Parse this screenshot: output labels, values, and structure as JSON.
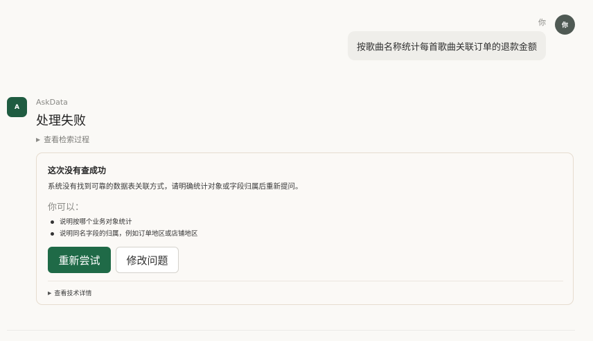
{
  "user": {
    "name": "你",
    "avatar_label": "你",
    "message": "按歌曲名称统计每首歌曲关联订单的退款金额"
  },
  "assistant": {
    "avatar_label": "A",
    "name": "AskData",
    "title": "处理失败",
    "search_process_label": "查看检索过程",
    "search_process_icon": "triangle-right-icon"
  },
  "error_card": {
    "title": "这次没有查成功",
    "description": "系统没有找到可靠的数据表关联方式，请明确统计对象或字段归属后重新提问。",
    "you_can": "你可以：",
    "suggestions": [
      "说明按哪个业务对象统计",
      "说明同名字段的归属，例如订单地区或店铺地区"
    ],
    "retry_label": "重新尝试",
    "edit_label": "修改问题",
    "tech_details_label": "查看技术详情",
    "tech_details_icon": "triangle-right-icon"
  },
  "colors": {
    "background": "#faf9f6",
    "accent": "#1f6a47",
    "bot_avatar": "#1f5c41",
    "user_avatar": "#4f5a54",
    "card_border": "#e6dccf",
    "user_bubble": "#efeeea"
  }
}
